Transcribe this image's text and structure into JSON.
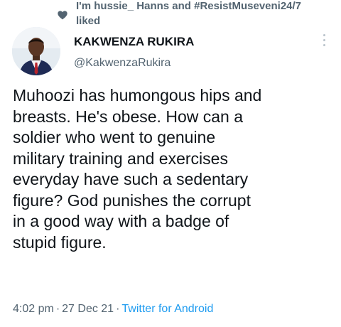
{
  "social_context": {
    "icon": "heart-icon",
    "line1": "I'm hussie_ Hanns and #ResistMuseveni24/7",
    "line2": "liked"
  },
  "author": {
    "name": "KAKWENZA RUKIRA",
    "handle": "@KakwenzaRukira",
    "avatar": "avatar",
    "menu_icon": "more-icon"
  },
  "tweet": {
    "lines": [
      "Muhoozi has humongous hips and",
      "breasts. He's obese. How can a",
      "soldier who went to genuine",
      "military training and exercises",
      "everyday have such a sedentary",
      "figure?  God punishes the corrupt",
      "in a good way with a badge of",
      "stupid figure."
    ]
  },
  "meta": {
    "time": "4:02 pm",
    "separator": "·",
    "date": "27 Dec 21",
    "source": "Twitter for Android"
  },
  "colors": {
    "text": "#0f1419",
    "secondary": "#536471",
    "link": "#1d9bf0"
  }
}
